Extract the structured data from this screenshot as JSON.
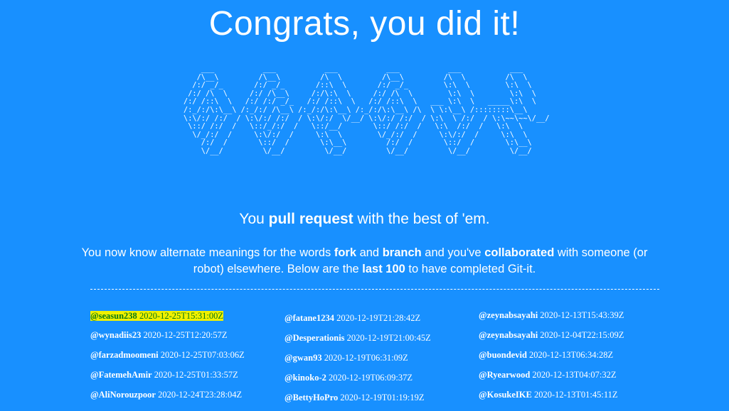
{
  "title": "Congrats, you did it!",
  "ascii_art": "    ___           ___           ___           ___           ___           ___     \n   /\\__\\         /\\__\\         /\\  \\         /\\__\\         /\\  \\         /\\  \\    \n  /:/ _/_       /:/ _/_       /::\\  \\       /:/ _/_        \\:\\  \\        \\:\\  \\   \n /:/ /\\  \\     /:/ /\\__\\     /:/\\:\\  \\     /:/ /\\  \\        \\:\\  \\        \\:\\  \\  \n/:/ /::\\  \\   /:/ /:/ _/_   /:/ /::\\  \\   /:/ /::\\  \\   ___ \\:\\  \\   _____\\:\\  \\ \n/:_/:/\\:\\__\\ /:_/:/ /\\__\\ /:_/:/\\:\\__\\ /:_/:/\\:\\__\\ /\\  \\ \\:\\__\\ /::::::::\\__\\\n\\:\\/:/ /:/  / \\:\\/:/ /:/  / \\:\\/:/  \\/__/ \\:\\/:/ /:/  / \\:\\  \\ /:/  / \\:\\~~\\~~\\/__/\n \\::/ /:/  /   \\::/_/:/  /   \\::/__/       \\::/ /:/  /   \\:\\  /:/  /   \\:\\  \\     \n  \\/_/:/  /     \\:\\/:/  /     \\:\\  \\        \\/_/:/  /     \\:\\/:/  /     \\:\\  \\    \n    /:/  /       \\::/  /       \\:\\__\\         /:/  /       \\::/  /       \\:\\__\\   \n    \\/__/         \\/__/         \\/__/         \\/__/         \\/__/         \\/__/   ",
  "subtitle": {
    "pre": "You ",
    "bold": "pull request",
    "post": " with the best of 'em."
  },
  "description": {
    "t1": "You now know alternate meanings for the words ",
    "b1": "fork",
    "t2": " and ",
    "b2": "branch",
    "t3": " and you've ",
    "b3": "collaborated",
    "t4": " with someone (or robot) elsewhere. Below are the ",
    "b4": "last 100",
    "t5": " to have completed Git-it."
  },
  "completions": {
    "col1": [
      {
        "user": "@seasun238",
        "time": "2020-12-25T15:31:00Z"
      },
      {
        "user": "@wynadiis23",
        "time": "2020-12-25T12:20:57Z"
      },
      {
        "user": "@farzadmoomeni",
        "time": "2020-12-25T07:03:06Z"
      },
      {
        "user": "@FatemehAmir",
        "time": "2020-12-25T01:33:57Z"
      },
      {
        "user": "@AliNorouzpoor",
        "time": "2020-12-24T23:28:04Z"
      }
    ],
    "col2": [
      {
        "user": "@fatane1234",
        "time": "2020-12-19T21:28:42Z"
      },
      {
        "user": "@Desperationis",
        "time": "2020-12-19T21:00:45Z"
      },
      {
        "user": "@gwan93",
        "time": "2020-12-19T06:31:09Z"
      },
      {
        "user": "@kinoko-2",
        "time": "2020-12-19T06:09:37Z"
      },
      {
        "user": "@BettyHoPro",
        "time": "2020-12-19T01:19:19Z"
      }
    ],
    "col3": [
      {
        "user": "@zeynabsayahi",
        "time": "2020-12-13T15:43:39Z"
      },
      {
        "user": "@zeynabsayahi",
        "time": "2020-12-04T22:15:09Z"
      },
      {
        "user": "@buondevid",
        "time": "2020-12-13T06:34:28Z"
      },
      {
        "user": "@Ryearwood",
        "time": "2020-12-13T04:07:32Z"
      },
      {
        "user": "@KosukeIKE",
        "time": "2020-12-13T01:45:11Z"
      }
    ]
  },
  "colors": {
    "background": "#1890ff",
    "highlight": "#f0f000",
    "highlight_text": "#0a7a12"
  }
}
